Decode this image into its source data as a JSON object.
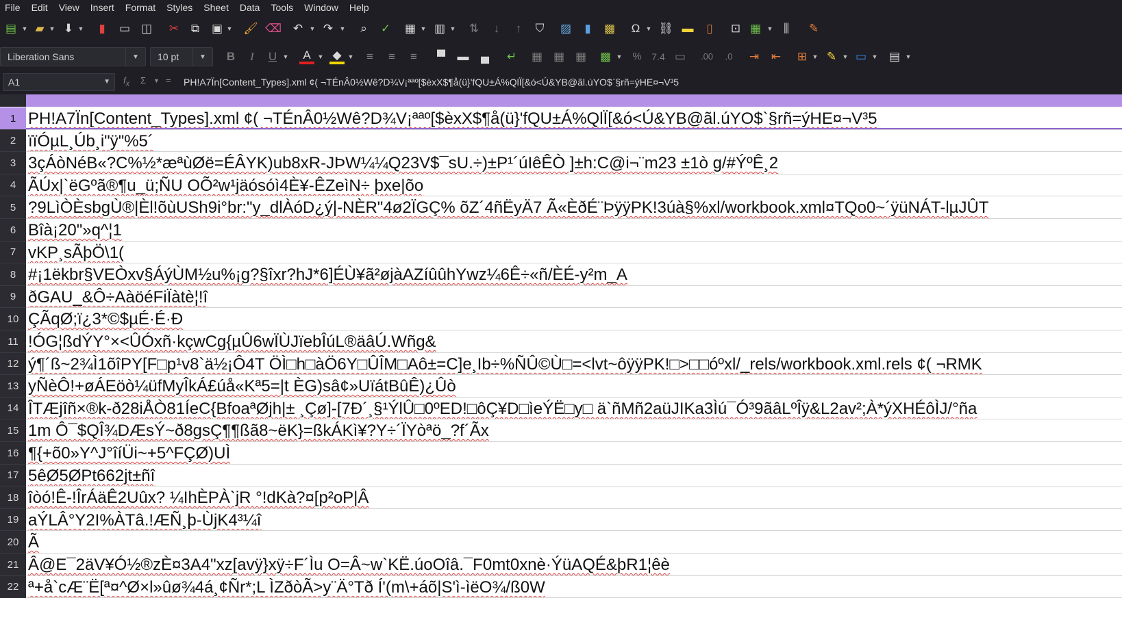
{
  "menu": [
    "File",
    "Edit",
    "View",
    "Insert",
    "Format",
    "Styles",
    "Sheet",
    "Data",
    "Tools",
    "Window",
    "Help"
  ],
  "toolbar1_icons": [
    "new-document-icon",
    "open-folder-icon",
    "save-icon",
    "export-pdf-icon",
    "print-icon",
    "print-preview-icon",
    "cut-icon",
    "copy-icon",
    "paste-icon",
    "clone-formatting-icon",
    "clear-formatting-icon",
    "undo-icon",
    "redo-icon",
    "find-replace-icon",
    "spellcheck-icon",
    "row-icon",
    "column-icon",
    "sort-icon",
    "sort-ascending-icon",
    "sort-descending-icon",
    "autofilter-icon",
    "insert-image-icon",
    "insert-chart-icon",
    "pivot-table-icon",
    "special-character-icon",
    "hyperlink-icon",
    "comment-icon",
    "headers-footers-icon",
    "define-print-area-icon",
    "freeze-rows-columns-icon",
    "split-window-icon",
    "show-draw-functions-icon"
  ],
  "font": {
    "name": "Liberation Sans",
    "size": "10 pt"
  },
  "colors": {
    "font_color": "#e0201f",
    "highlight_color": "#f2d600",
    "header_accent": "#b490e6",
    "spell_underline": "#e04040"
  },
  "formula_bar": {
    "cell_ref": "A1",
    "content": "PH!A7Ïn[Content_Types].xml ¢( ¬TÉnÂ0½Wê?D¾V¡ªªº[$èxX$¶å(ü}'fQU±Á%QlÏ[&ó<Ú&YB@ãl.úYO$`§rñ=ýHE¤¬V³5"
  },
  "rows": [
    {
      "num": "1",
      "text": "PH!A7Ïn[Content_Types].xml ¢( ¬TÉnÂ0½Wê?D¾V¡ªªº[$èxX$¶å(ü}'fQU±Á%QlÏ[&ó<Ú&YB@ãl.úYO$`§rñ=ýHE¤¬V³5"
    },
    {
      "num": "2",
      "text": "ïïÓµL¸Úb¸i\"ÿ\"%5´"
    },
    {
      "num": "3",
      "text": "3çÁòNéB«?C%½*æªùØë=ÉÂYK)ub8xR-JÞW¼¼Q23V$¯sU.÷)±P¹´úIêÊÒ ]±h:C@i¬¨m23   ±1ò g/#ÝºÊ¸2"
    },
    {
      "num": "4",
      "text": "ÃÚx|`ëGºã®¶u_ü;ÑU OÕ²w¹jäósóì4È¥-ÊZeìN÷     þxe|õo"
    },
    {
      "num": "5",
      "text": "?9LìÒÈsbgÙ®|Èl!õùUSh9i°br:\"y_dlÀóD¿ý|-NÈR\"4ø2ÏGÇ% õZ´4ñËyÄ7    Ã«ÈðÉ¨ÞÿÿPK!3úà§%xl/workbook.xml¤TQo0~´ÿüNÁT-lµJÛT"
    },
    {
      "num": "6",
      "text": "Bîà¡20\"»q^¦1"
    },
    {
      "num": "7",
      "text": "vKP¸sÃþÖ\\1("
    },
    {
      "num": "8",
      "text": "#¡1ëkbr§VEÒxv§ÁýÙM½u%¡g?§îxr?hJ*6]ÉÙ¥ã²øjàAZíûûhYwz¼6Ê÷«ñ/ÈÉ-y²m_A"
    },
    {
      "num": "9",
      "text": "ðGAU_&Ô÷AàöéFiÏàtè¦!î"
    },
    {
      "num": "10",
      "text": "ÇÃqØ;ï¿3*©$µÉ·É·Ð"
    },
    {
      "num": "11",
      "text": "!ÓG¦ßdÝY°×<ÛÓxñ·kçwCg{µÛ6wÏÙJïebÎúL®äâÚ.Wñg&"
    },
    {
      "num": "12",
      "text": "ý¶´ß~2¾Ì1õîPY[F□p¹v8`ä½¡Ô4T ÖÌ□h□àÖ6Y□ÛÎM□Aô±=C]e¸Ib÷%ÑÛ©Ù□=<lvt~ôÿÿPK!□>□□óºxl/_rels/workbook.xml.rels ¢( ¬RMK"
    },
    {
      "num": "13",
      "text": "yÑèÔ!+øÁEöò¼üfMyÎkÁ£úå«Kª5=|t ÈG)sâ¢»UïátBûÊ)¿Ûò"
    },
    {
      "num": "14",
      "text": "ÎTÆjîñ×®k-ð28iÅÒ81ÍeC{BfoaªØjh|± ¸Çø]-[7Ð´¸§¹ÝlÛ□0ºED!□ôÇ¥D□ìeÝË□y□     ä`ñMñ2aüJIKa3Ìú¯Ó³9ãâLºÎÿ&L2av²;À*ýXHÉôÌJ/°ña"
    },
    {
      "num": "15",
      "text": "1m Ô¯$QÎ¾DÆsÝ~ð8gsÇ¶¶ßã8~ëK}=ßkÁKì¥?Y÷´ÏYòªö_?f´Ãx"
    },
    {
      "num": "16",
      "text": "¶{+õ0»Y^J°îíÜi~+5^FÇØ)UÌ"
    },
    {
      "num": "17",
      "text": "5êØ5ØPt662jt±ñî"
    },
    {
      "num": "18",
      "text": "îòó!Ê-!ÎrÁäÊ2Uûx? ¼IhÈPÀ`jR  °!dKà?¤[p²oP|Â"
    },
    {
      "num": "19",
      "text": "aÝLÂ°Y2I%ÀTâ.!ÆÑ¸þ-ÙjK4³¼î"
    },
    {
      "num": "20",
      "text": "Ã"
    },
    {
      "num": "21",
      "text": "Â@E¯2äV¥Ó½®zÈ¤3A4\"xz[avÿ}xÿ÷F´Ìu O=Â~w`KË.úoOîâ.¯F0mt0xnè·ÝüAQÉ&þR1¦êè"
    },
    {
      "num": "22",
      "text": "ª+å`cÆ¨Ë[ª¤^Ø×l»ûø¾4á¸¢Ñr*;L ÌZðòÃ>y¨Ä°Tð Í'(m\\+áõ|S'ì-ìëO¾/ß0W"
    }
  ]
}
